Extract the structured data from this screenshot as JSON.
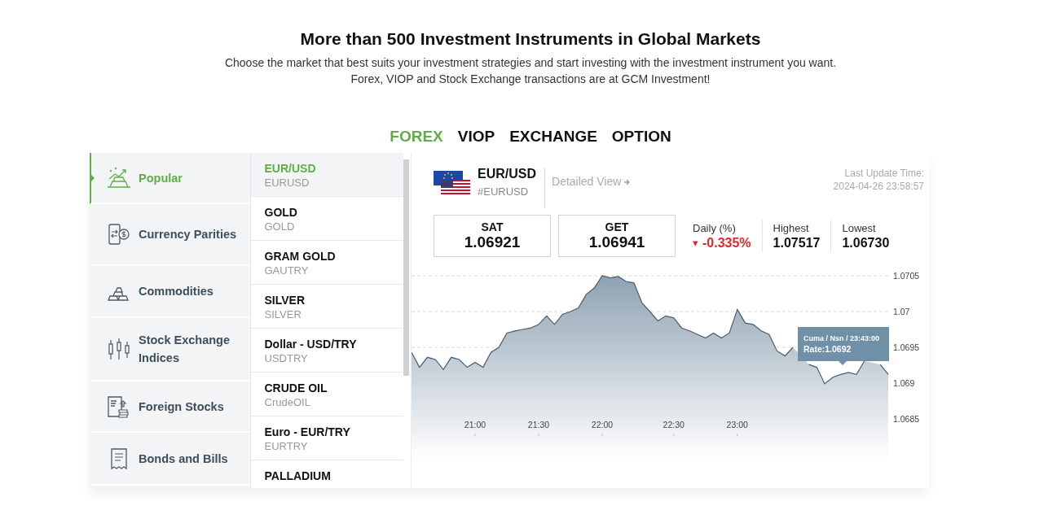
{
  "header": {
    "title": "More than 500 Investment Instruments in Global Markets",
    "subtitle_lines": [
      "Choose the market that best suits your investment strategies and start investing with the investment instrument you want.",
      "Forex, VIOP and Stock Exchange transactions are at GCM Investment!"
    ]
  },
  "market_tabs": [
    {
      "label": "FOREX",
      "selected": true
    },
    {
      "label": "VIOP",
      "selected": false
    },
    {
      "label": "EXCHANGE",
      "selected": false
    },
    {
      "label": "OPTION",
      "selected": false
    }
  ],
  "categories": [
    {
      "label": "Popular",
      "kind": "popular",
      "selected": true
    },
    {
      "label": "Currency Parities",
      "kind": "currency",
      "selected": false
    },
    {
      "label": "Commodities",
      "kind": "commodities",
      "selected": false
    },
    {
      "label": "Stock Exchange Indices",
      "kind": "indices",
      "selected": false
    },
    {
      "label": "Foreign Stocks",
      "kind": "stocks",
      "selected": false
    },
    {
      "label": "Bonds and Bills",
      "kind": "bonds",
      "selected": false
    }
  ],
  "instruments": [
    {
      "name": "EUR/USD",
      "code": "EURUSD",
      "selected": true
    },
    {
      "name": "GOLD",
      "code": "GOLD",
      "selected": false
    },
    {
      "name": "GRAM GOLD",
      "code": "GAUTRY",
      "selected": false
    },
    {
      "name": "SILVER",
      "code": "SILVER",
      "selected": false
    },
    {
      "name": "Dollar - USD/TRY",
      "code": "USDTRY",
      "selected": false
    },
    {
      "name": "CRUDE OIL",
      "code": "CrudeOIL",
      "selected": false
    },
    {
      "name": "Euro - EUR/TRY",
      "code": "EURTRY",
      "selected": false
    },
    {
      "name": "PALLADIUM",
      "selected": false
    }
  ],
  "detail": {
    "symbol": "EUR/USD",
    "code": "#EURUSD",
    "detailed_view": "Detailed View",
    "last_update_label": "Last Update Time:",
    "last_update_time": "2024-04-26 23:58:57",
    "quotes": [
      {
        "label": "SAT",
        "value": "1.06921"
      },
      {
        "label": "GET",
        "value": "1.06941"
      }
    ],
    "stats": [
      {
        "label": "Daily (%)",
        "value": "-0.335%",
        "icon": "▾",
        "negative": true
      },
      {
        "label": "Highest",
        "value": "1.07517",
        "negative": false
      },
      {
        "label": "Lowest",
        "value": "1.06730",
        "negative": false
      }
    ]
  },
  "tooltip": {
    "title": "Cuma / Nsn / 23:43:00",
    "rate": "Rate:1.0692"
  },
  "chart_data": {
    "type": "area",
    "categories": [
      null,
      null,
      null,
      null,
      null,
      null,
      null,
      null,
      "21:00",
      null,
      null,
      null,
      null,
      null,
      null,
      null,
      "21:30",
      null,
      null,
      null,
      null,
      null,
      null,
      null,
      "22:00",
      null,
      null,
      null,
      null,
      null,
      null,
      null,
      null,
      "22:30",
      null,
      null,
      null,
      null,
      null,
      null,
      null,
      "23:00",
      null,
      null,
      null,
      null,
      null,
      null,
      null,
      null,
      null,
      null,
      null,
      null,
      null,
      null,
      null,
      null,
      null,
      null,
      null
    ],
    "series": [
      {
        "color": "#4a5c6b",
        "values": [
          1.06943,
          1.06922,
          1.06936,
          1.06933,
          1.06919,
          1.06936,
          1.06933,
          1.06922,
          1.06929,
          1.06922,
          1.06943,
          1.0695,
          1.0697,
          1.06973,
          1.06975,
          1.06977,
          1.06982,
          1.06994,
          1.06982,
          1.06996,
          1.07,
          1.07005,
          1.07024,
          1.07033,
          1.0705,
          1.07047,
          1.07049,
          1.07042,
          1.0704,
          1.07012,
          1.07,
          1.06987,
          1.06994,
          1.06991,
          1.06977,
          1.06973,
          1.06968,
          1.06963,
          1.0697,
          1.06963,
          1.0697,
          1.07003,
          1.06984,
          1.06982,
          1.06973,
          1.06968,
          1.06945,
          1.06938,
          1.0695,
          null,
          1.06926,
          1.06922,
          1.06899,
          1.06908,
          1.06912,
          1.06915,
          1.06912,
          1.06931,
          null,
          1.06926,
          1.06912
        ]
      }
    ],
    "grid": true,
    "ylim": [
      1.0685,
      1.0705
    ],
    "yticks": [
      {
        "value": 1.0685,
        "label": "1.0685"
      },
      {
        "value": 1.069,
        "label": "1.069"
      },
      {
        "value": 1.0695,
        "label": "1.0695"
      },
      {
        "value": 1.07,
        "label": "1.07"
      },
      {
        "value": 1.0705,
        "label": "1.0705"
      }
    ]
  }
}
